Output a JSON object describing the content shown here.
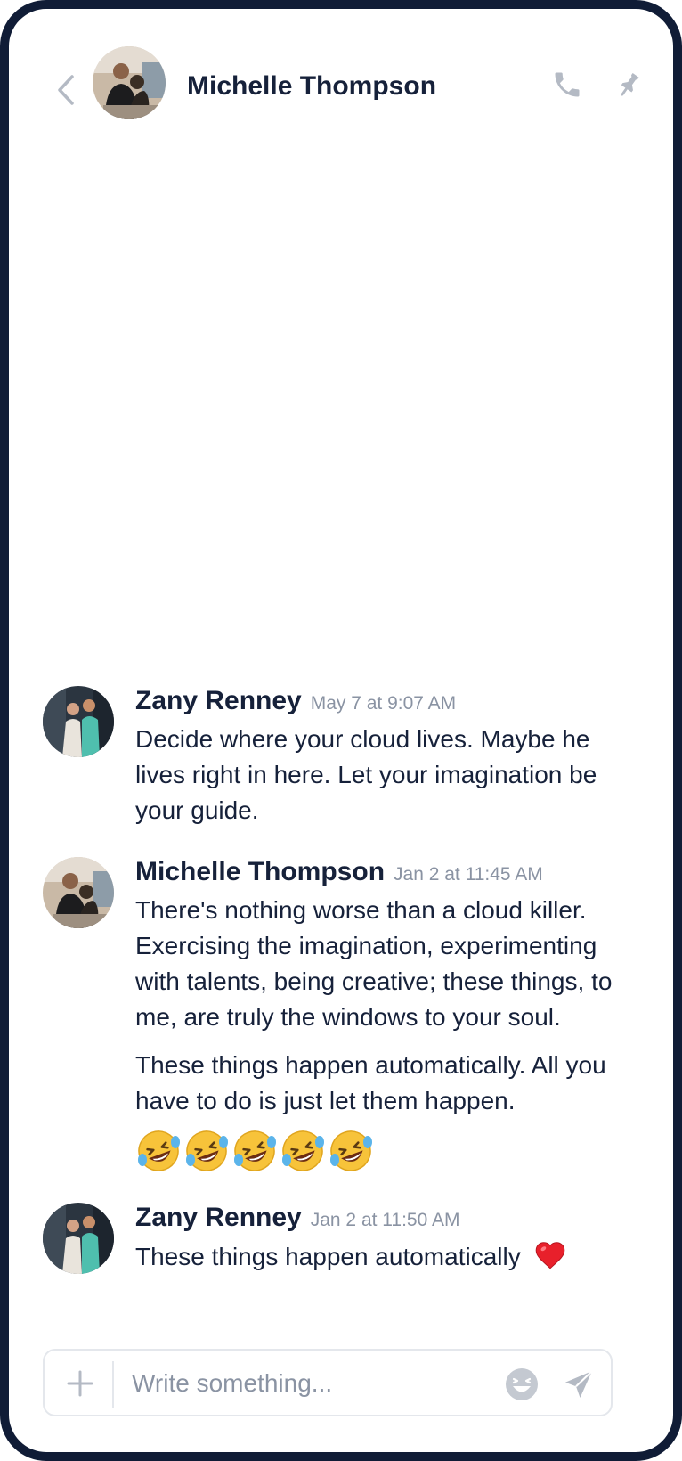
{
  "header": {
    "contact_name": "Michelle Thompson",
    "icons": {
      "back": "chevron-left-icon",
      "call": "phone-icon",
      "pin": "pin-icon"
    }
  },
  "messages": [
    {
      "author": "Zany Renney",
      "time": "May 7 at 9:07 AM",
      "paragraphs": [
        "Decide where your cloud lives. Maybe he lives right in here. Let your imagination be your guide."
      ]
    },
    {
      "author": "Michelle Thompson",
      "time": "Jan 2 at 11:45 AM",
      "paragraphs": [
        "There's nothing worse than a cloud killer. Exercising the imagination, experimenting with talents, being creative; these things, to me, are truly the windows to your soul.",
        "These things happen automatically. All you have to do is just let them happen."
      ],
      "emojis": [
        "rolling-on-floor-laughing",
        "rolling-on-floor-laughing",
        "rolling-on-floor-laughing",
        "rolling-on-floor-laughing",
        "rolling-on-floor-laughing"
      ]
    },
    {
      "author": "Zany Renney",
      "time": "Jan 2 at 11:50 AM",
      "paragraphs": [
        "These things happen automatically"
      ],
      "trailing_emoji": "red-heart"
    }
  ],
  "composer": {
    "placeholder": "Write something...",
    "value": "",
    "icons": {
      "add": "plus-icon",
      "emoji": "emoji-icon",
      "send": "send-icon"
    }
  },
  "colors": {
    "frame": "#101c36",
    "text": "#16213a",
    "muted": "#8a93a3",
    "icon": "#b4bac4",
    "border": "#e4e7ec"
  }
}
